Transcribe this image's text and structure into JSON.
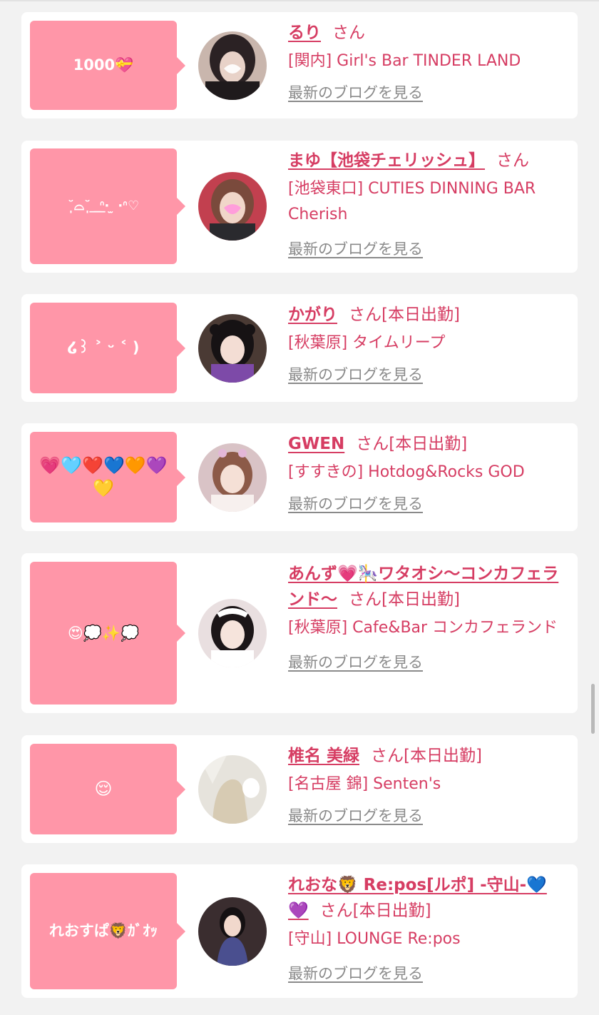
{
  "blog_link_label": "最新のブログを見る",
  "colors": {
    "bubble": "#ff96a8",
    "accent": "#d63d63",
    "link_gray": "#8a8a8a"
  },
  "cards": [
    {
      "bubble": "1000💝",
      "name": "るり",
      "suffix": "さん",
      "shop": "[関内] Girl's Bar TINDER LAND"
    },
    {
      "bubble": "˘̩̩̩⌓˘̩̩̩ ͟ ͟ᐢ‧ ̫ ‧ᐢ♡",
      "name": "まゆ【池袋チェリッシュ】",
      "suffix": "さん",
      "shop": "[池袋東口] CUTIES DINNING BAR Cherish"
    },
    {
      "bubble": "໒꒱ ˃ ᵕ ˂ )",
      "name": "かがり",
      "suffix": "さん[本日出勤]",
      "shop": "[秋葉原] タイムリープ"
    },
    {
      "bubble": "💗🩵❤️💙🧡💜💛",
      "name": "GWEN",
      "suffix": "さん[本日出勤]",
      "shop": "[すすきの] Hotdog&Rocks GOD"
    },
    {
      "bubble": "😍💭✨💭",
      "name": "あんず💗🎠ワタオシ〜コンカフェランド〜",
      "suffix": "さん[本日出勤]",
      "shop": "[秋葉原] Cafe&Bar コンカフェランド"
    },
    {
      "bubble": "😌",
      "name": "椎名 美緑",
      "suffix": "さん[本日出勤]",
      "shop": "[名古屋 錦] Senten's"
    },
    {
      "bubble": "れおすぱ🦁ｶﾞｵｯ",
      "name": "れおな🦁 Re:pos[ルポ] -守山-💙💜",
      "suffix": "さん[本日出勤]",
      "shop": "[守山] LOUNGE Re:pos"
    }
  ]
}
